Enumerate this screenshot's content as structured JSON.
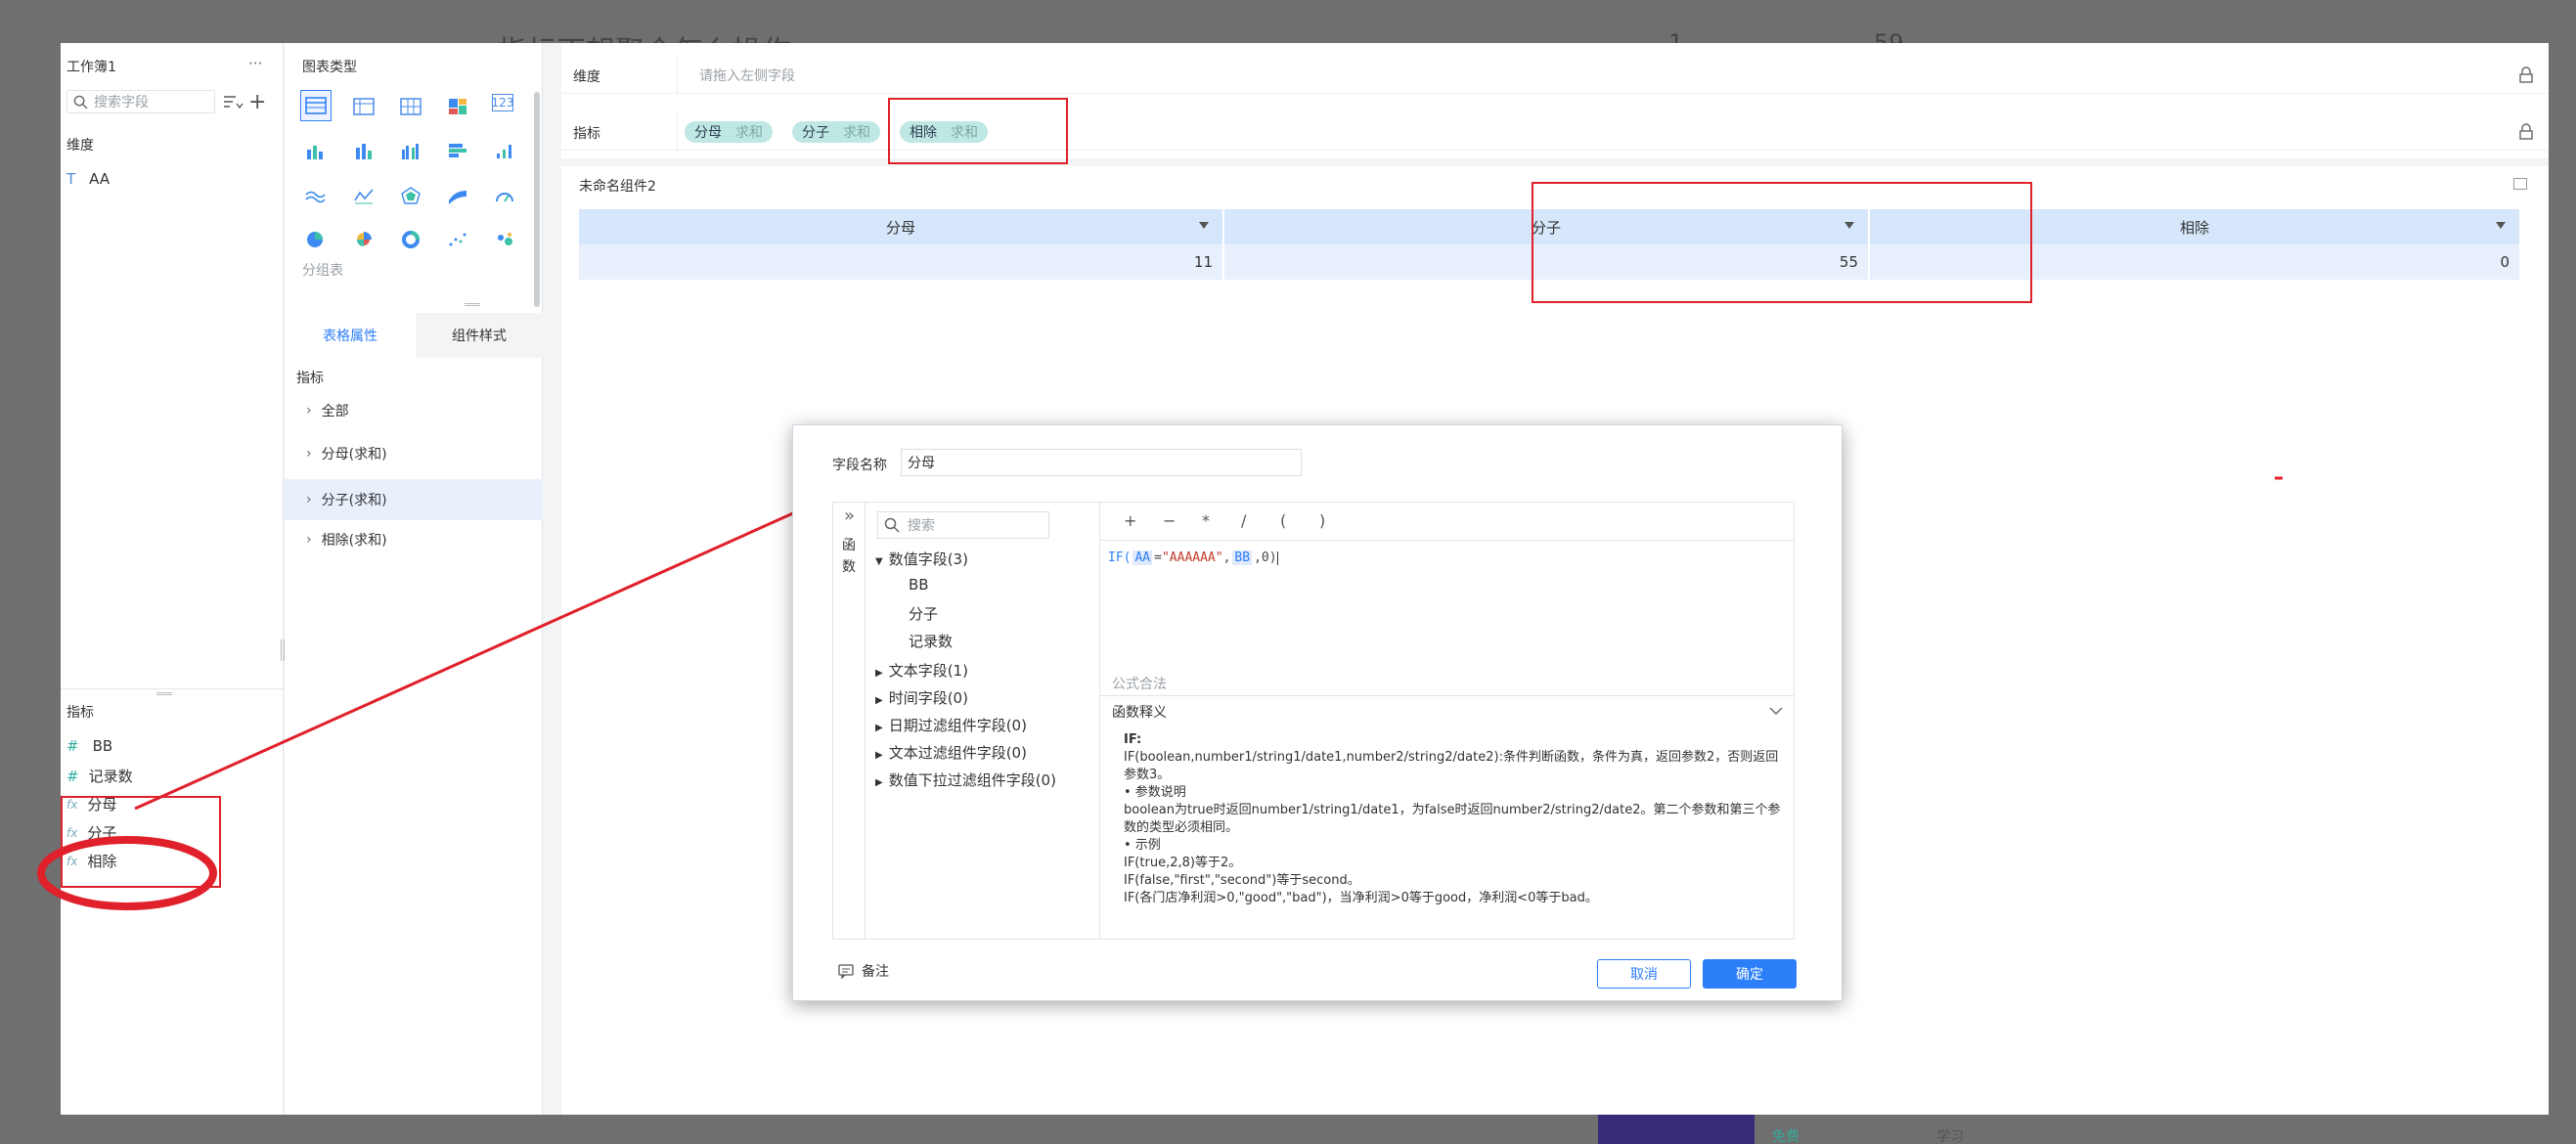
{
  "background": {
    "title_fragment": "指标不想聚合怎么操作",
    "num1": "1",
    "num2": "59",
    "bottom_a": "免费",
    "bottom_b": "学习"
  },
  "left_panel": {
    "workbook_title": "工作簿1",
    "more": "···",
    "search_placeholder": "搜索字段",
    "dimension_label": "维度",
    "dimension_fields": [
      {
        "type_icon": "T",
        "name": "AA"
      }
    ],
    "measure_label": "指标",
    "measure_fields": [
      {
        "type_icon": "#",
        "name": "BB"
      },
      {
        "type_icon": "#",
        "name": "记录数"
      },
      {
        "type_icon": "fx",
        "name": "分母"
      },
      {
        "type_icon": "fx",
        "name": "分子"
      },
      {
        "type_icon": "fx",
        "name": "相除"
      }
    ]
  },
  "mid_panel": {
    "chart_type_label": "图表类型",
    "chart_type_caption": "分组表",
    "tabs": [
      "表格属性",
      "组件样式"
    ],
    "active_tab": "表格属性",
    "section_label": "指标",
    "tree_items": [
      "全部",
      "分母(求和)",
      "分子(求和)",
      "相除(求和)"
    ],
    "selected_tree_item": "分子(求和)"
  },
  "main": {
    "dimension_row_label": "维度",
    "dimension_placeholder": "请拖入左侧字段",
    "measure_row_label": "指标",
    "measure_chips": [
      {
        "name": "分母",
        "agg": "求和"
      },
      {
        "name": "分子",
        "agg": "求和"
      },
      {
        "name": "相除",
        "agg": "求和"
      }
    ],
    "component_title": "未命名组件2",
    "table": {
      "headers": [
        "分母",
        "分子",
        "相除"
      ],
      "values": [
        "11",
        "55",
        "0"
      ]
    }
  },
  "dialog": {
    "field_name_label": "字段名称",
    "field_name_value": "分母",
    "expand_glyph": "»",
    "func_tab_label": "函数",
    "search_placeholder": "搜索",
    "operators": [
      "+",
      "−",
      "*",
      "/",
      "(",
      ")"
    ],
    "field_tree": [
      {
        "label": "数值字段(3)",
        "expanded": true,
        "children": [
          "BB",
          "分子",
          "记录数"
        ]
      },
      {
        "label": "文本字段(1)",
        "expanded": false
      },
      {
        "label": "时间字段(0)",
        "expanded": false
      },
      {
        "label": "日期过滤组件字段(0)",
        "expanded": false
      },
      {
        "label": "文本过滤组件字段(0)",
        "expanded": false
      },
      {
        "label": "数值下拉过滤组件字段(0)",
        "expanded": false
      }
    ],
    "formula": {
      "fn": "IF(",
      "field1": "AA",
      "eq": "=",
      "str": "\"AAAAAA\"",
      "comma1": ",",
      "field2": "BB",
      "rest": ",0)"
    },
    "valid_msg": "公式合法",
    "explain_title": "函数释义",
    "explain_lines": [
      "IF:",
      "IF(boolean,number1/string1/date1,number2/string2/date2):条件判断函数，条件为真，返回参数2，否则返回",
      "参数3。",
      "• 参数说明",
      "boolean为true时返回number1/string1/date1，为false时返回number2/string2/date2。第二个参数和第三个参",
      "数的类型必须相同。",
      "• 示例",
      "IF(true,2,8)等于2。",
      "IF(false,\"first\",\"second\")等于second。",
      "IF(各门店净利润>0,\"good\",\"bad\")，当净利润>0等于good，净利润<0等于bad。"
    ],
    "remark_label": "备注",
    "cancel_label": "取消",
    "confirm_label": "确定"
  },
  "colors": {
    "accent": "#2d7ff9",
    "chip_bg": "#bfe8e4",
    "annotation_red": "#e0202a",
    "table_header_bg": "#d6e6fb"
  }
}
